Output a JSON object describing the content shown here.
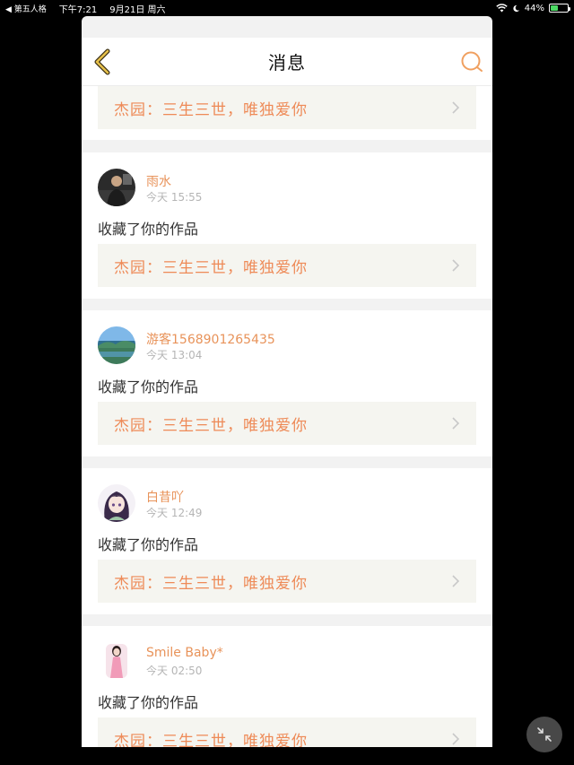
{
  "status": {
    "back_app": "◀ 第五人格",
    "time": "下午7:21",
    "date": "9月21日 周六",
    "battery": "44%",
    "battery_level": 0.44
  },
  "header": {
    "title": "消息"
  },
  "work_title": "杰园：三生三世，唯独爱你",
  "messages": [
    {
      "user": "雨水",
      "time": "今天 15:55",
      "action": "收藏了你的作品"
    },
    {
      "user": "游客1568901265435",
      "time": "今天 13:04",
      "action": "收藏了你的作品"
    },
    {
      "user": "白昔吖",
      "time": "今天 12:49",
      "action": "收藏了你的作品"
    },
    {
      "user": "Smile Baby*",
      "time": "今天 02:50",
      "action": "收藏了你的作品"
    }
  ],
  "colors": {
    "accent": "#e8935a",
    "work_bg": "#f5f5f0"
  }
}
